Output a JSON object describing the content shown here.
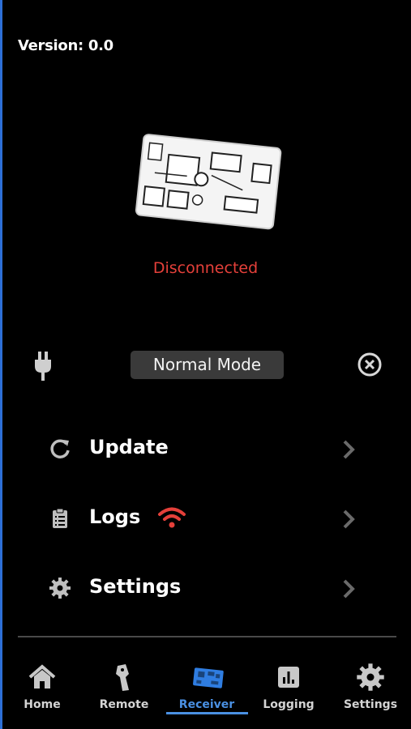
{
  "header": {
    "version_text": "Version: 0.0"
  },
  "device": {
    "image_name": "receiver-board",
    "status": "Disconnected",
    "status_color": "#e5403a"
  },
  "mode": {
    "label": "Normal Mode",
    "icons": [
      "plug-icon",
      "close-circle-icon"
    ]
  },
  "menu": {
    "items": [
      {
        "label": "Update",
        "icon": "refresh-icon"
      },
      {
        "label": "Logs",
        "icon": "clipboard-icon",
        "indicator_icon": "wifi-icon",
        "indicator_color": "#e5403a"
      },
      {
        "label": "Settings",
        "icon": "gear-icon"
      }
    ]
  },
  "tabs": {
    "items": [
      {
        "label": "Home",
        "icon": "home-icon"
      },
      {
        "label": "Remote",
        "icon": "remote-icon"
      },
      {
        "label": "Receiver",
        "icon": "receiver-icon",
        "active": true
      },
      {
        "label": "Logging",
        "icon": "chart-icon"
      },
      {
        "label": "Settings",
        "icon": "gear-icon"
      }
    ],
    "active_color": "#4a90e2"
  },
  "colors": {
    "background": "#000000",
    "accent": "#4a90e2",
    "pill": "#3a3a3a"
  }
}
